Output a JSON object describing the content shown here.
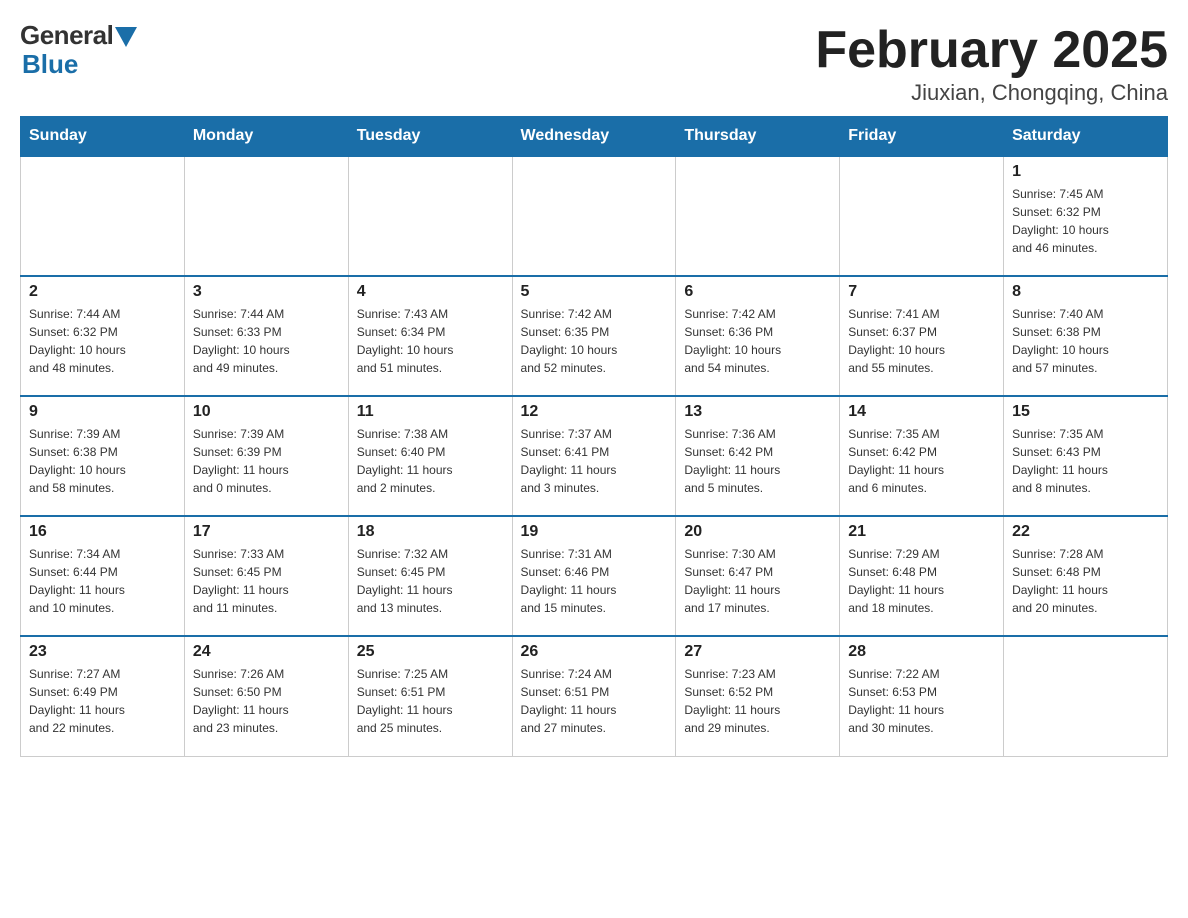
{
  "logo": {
    "general": "General",
    "blue": "Blue"
  },
  "title": "February 2025",
  "subtitle": "Jiuxian, Chongqing, China",
  "days_of_week": [
    "Sunday",
    "Monday",
    "Tuesday",
    "Wednesday",
    "Thursday",
    "Friday",
    "Saturday"
  ],
  "weeks": [
    [
      {
        "day": "",
        "info": ""
      },
      {
        "day": "",
        "info": ""
      },
      {
        "day": "",
        "info": ""
      },
      {
        "day": "",
        "info": ""
      },
      {
        "day": "",
        "info": ""
      },
      {
        "day": "",
        "info": ""
      },
      {
        "day": "1",
        "info": "Sunrise: 7:45 AM\nSunset: 6:32 PM\nDaylight: 10 hours\nand 46 minutes."
      }
    ],
    [
      {
        "day": "2",
        "info": "Sunrise: 7:44 AM\nSunset: 6:32 PM\nDaylight: 10 hours\nand 48 minutes."
      },
      {
        "day": "3",
        "info": "Sunrise: 7:44 AM\nSunset: 6:33 PM\nDaylight: 10 hours\nand 49 minutes."
      },
      {
        "day": "4",
        "info": "Sunrise: 7:43 AM\nSunset: 6:34 PM\nDaylight: 10 hours\nand 51 minutes."
      },
      {
        "day": "5",
        "info": "Sunrise: 7:42 AM\nSunset: 6:35 PM\nDaylight: 10 hours\nand 52 minutes."
      },
      {
        "day": "6",
        "info": "Sunrise: 7:42 AM\nSunset: 6:36 PM\nDaylight: 10 hours\nand 54 minutes."
      },
      {
        "day": "7",
        "info": "Sunrise: 7:41 AM\nSunset: 6:37 PM\nDaylight: 10 hours\nand 55 minutes."
      },
      {
        "day": "8",
        "info": "Sunrise: 7:40 AM\nSunset: 6:38 PM\nDaylight: 10 hours\nand 57 minutes."
      }
    ],
    [
      {
        "day": "9",
        "info": "Sunrise: 7:39 AM\nSunset: 6:38 PM\nDaylight: 10 hours\nand 58 minutes."
      },
      {
        "day": "10",
        "info": "Sunrise: 7:39 AM\nSunset: 6:39 PM\nDaylight: 11 hours\nand 0 minutes."
      },
      {
        "day": "11",
        "info": "Sunrise: 7:38 AM\nSunset: 6:40 PM\nDaylight: 11 hours\nand 2 minutes."
      },
      {
        "day": "12",
        "info": "Sunrise: 7:37 AM\nSunset: 6:41 PM\nDaylight: 11 hours\nand 3 minutes."
      },
      {
        "day": "13",
        "info": "Sunrise: 7:36 AM\nSunset: 6:42 PM\nDaylight: 11 hours\nand 5 minutes."
      },
      {
        "day": "14",
        "info": "Sunrise: 7:35 AM\nSunset: 6:42 PM\nDaylight: 11 hours\nand 6 minutes."
      },
      {
        "day": "15",
        "info": "Sunrise: 7:35 AM\nSunset: 6:43 PM\nDaylight: 11 hours\nand 8 minutes."
      }
    ],
    [
      {
        "day": "16",
        "info": "Sunrise: 7:34 AM\nSunset: 6:44 PM\nDaylight: 11 hours\nand 10 minutes."
      },
      {
        "day": "17",
        "info": "Sunrise: 7:33 AM\nSunset: 6:45 PM\nDaylight: 11 hours\nand 11 minutes."
      },
      {
        "day": "18",
        "info": "Sunrise: 7:32 AM\nSunset: 6:45 PM\nDaylight: 11 hours\nand 13 minutes."
      },
      {
        "day": "19",
        "info": "Sunrise: 7:31 AM\nSunset: 6:46 PM\nDaylight: 11 hours\nand 15 minutes."
      },
      {
        "day": "20",
        "info": "Sunrise: 7:30 AM\nSunset: 6:47 PM\nDaylight: 11 hours\nand 17 minutes."
      },
      {
        "day": "21",
        "info": "Sunrise: 7:29 AM\nSunset: 6:48 PM\nDaylight: 11 hours\nand 18 minutes."
      },
      {
        "day": "22",
        "info": "Sunrise: 7:28 AM\nSunset: 6:48 PM\nDaylight: 11 hours\nand 20 minutes."
      }
    ],
    [
      {
        "day": "23",
        "info": "Sunrise: 7:27 AM\nSunset: 6:49 PM\nDaylight: 11 hours\nand 22 minutes."
      },
      {
        "day": "24",
        "info": "Sunrise: 7:26 AM\nSunset: 6:50 PM\nDaylight: 11 hours\nand 23 minutes."
      },
      {
        "day": "25",
        "info": "Sunrise: 7:25 AM\nSunset: 6:51 PM\nDaylight: 11 hours\nand 25 minutes."
      },
      {
        "day": "26",
        "info": "Sunrise: 7:24 AM\nSunset: 6:51 PM\nDaylight: 11 hours\nand 27 minutes."
      },
      {
        "day": "27",
        "info": "Sunrise: 7:23 AM\nSunset: 6:52 PM\nDaylight: 11 hours\nand 29 minutes."
      },
      {
        "day": "28",
        "info": "Sunrise: 7:22 AM\nSunset: 6:53 PM\nDaylight: 11 hours\nand 30 minutes."
      },
      {
        "day": "",
        "info": ""
      }
    ]
  ]
}
